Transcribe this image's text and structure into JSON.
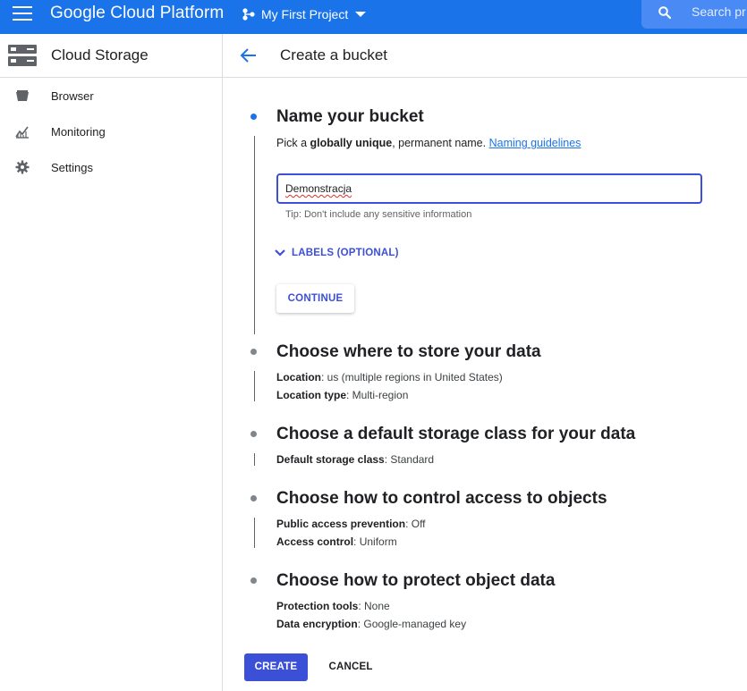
{
  "header": {
    "brand": "Google Cloud Platform",
    "project_name": "My First Project",
    "search_placeholder": "Search pr"
  },
  "sidebar": {
    "title": "Cloud Storage",
    "items": [
      {
        "label": "Browser",
        "icon": "bucket-icon"
      },
      {
        "label": "Monitoring",
        "icon": "chart-icon"
      },
      {
        "label": "Settings",
        "icon": "gear-icon"
      }
    ]
  },
  "main": {
    "title": "Create a bucket",
    "steps": [
      {
        "heading": "Name your bucket",
        "pick_prefix": "Pick a ",
        "pick_bold": "globally unique",
        "pick_suffix": ", permanent name. ",
        "link": "Naming guidelines",
        "input_value": "Demonstracja",
        "tip": "Tip: Don't include any sensitive information",
        "labels_toggle": "LABELS (OPTIONAL)",
        "continue": "CONTINUE"
      },
      {
        "heading": "Choose where to store your data",
        "details": [
          {
            "key": "Location",
            "value": ": us (multiple regions in United States)"
          },
          {
            "key": "Location type",
            "value": ": Multi-region"
          }
        ]
      },
      {
        "heading": "Choose a default storage class for your data",
        "details": [
          {
            "key": "Default storage class",
            "value": ": Standard"
          }
        ]
      },
      {
        "heading": "Choose how to control access to objects",
        "details": [
          {
            "key": "Public access prevention",
            "value": ": Off"
          },
          {
            "key": "Access control",
            "value": ": Uniform"
          }
        ]
      },
      {
        "heading": "Choose how to protect object data",
        "details": [
          {
            "key": "Protection tools",
            "value": ": None"
          },
          {
            "key": "Data encryption",
            "value": ": Google-managed key"
          }
        ]
      }
    ],
    "create": "CREATE",
    "cancel": "CANCEL"
  },
  "colors": {
    "topbar": "#1a73e8",
    "accent": "#3c4fd7",
    "active_dot": "#1a73e8",
    "inactive_dot": "#80868b"
  }
}
